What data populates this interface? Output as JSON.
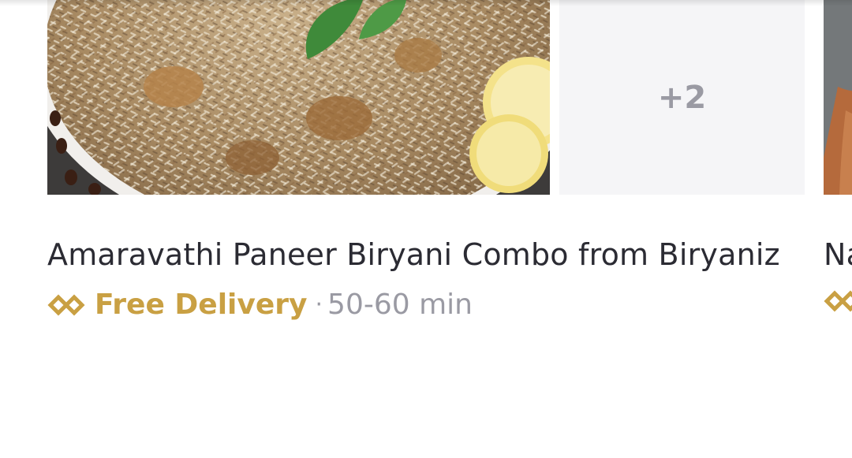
{
  "carousel": {
    "items": [
      {
        "title": "Amaravathi Paneer Biryani Combo from Biryaniz",
        "more_count_label": "+2",
        "delivery_label": "Free Delivery",
        "separator": "·",
        "eta": "50-60 min",
        "delivery_icon": "diamond-chain-icon",
        "accent_color": "#c9a043"
      },
      {
        "title": "Na",
        "delivery_icon": "diamond-chain-icon"
      }
    ]
  },
  "colors": {
    "title": "#2b2b33",
    "muted": "#9a9aa3",
    "accent": "#c9a043",
    "tile_bg": "#f5f5f7"
  }
}
